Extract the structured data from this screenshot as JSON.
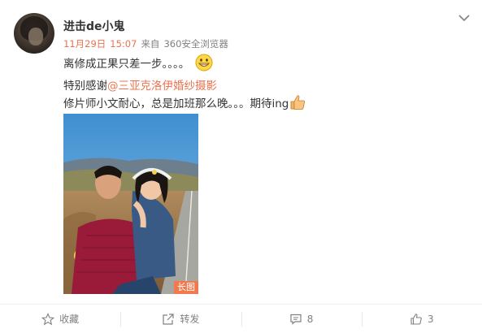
{
  "post": {
    "username": "进击de小鬼",
    "date": "11月29日",
    "time": "15:07",
    "source_prefix": "来自",
    "source": "360安全浏览器",
    "line1": "离修成正果只差一步。。。。",
    "line2_prefix": "特别感谢",
    "mention": "@三亚克洛伊婚纱摄影",
    "line3": "修片师小文耐心，总是加班那么晚。。。期待ing",
    "photo_badge": "长图",
    "icons": [
      "grin-emoji-icon",
      "thumbs-up-emoji-icon",
      "chevron-down-icon"
    ]
  },
  "actions": [
    {
      "name": "collect",
      "icon": "star-icon",
      "label": "收藏"
    },
    {
      "name": "repost",
      "icon": "repost-icon",
      "label": "转发"
    },
    {
      "name": "comment",
      "icon": "comment-icon",
      "label": "8"
    },
    {
      "name": "like",
      "icon": "thumbs-up-icon",
      "label": "3"
    }
  ],
  "colors": {
    "accent": "#eb7350",
    "text": "#333333",
    "muted": "#808080",
    "badge": "#f07a4d"
  }
}
